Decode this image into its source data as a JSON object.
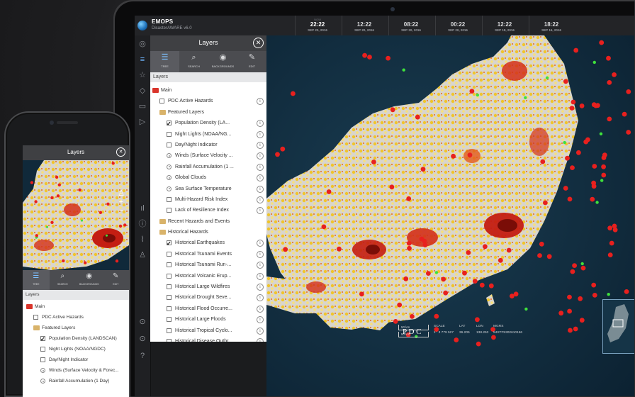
{
  "app": {
    "name": "EMOPS",
    "subtitle": "DisasterAWARE v6.0"
  },
  "timeline": [
    {
      "time": "22:22",
      "date": "SEP 20, 2016",
      "label": "NOW",
      "now": true
    },
    {
      "time": "12:22",
      "date": "SEP 20, 2016",
      "label": ""
    },
    {
      "time": "08:22",
      "date": "SEP 20, 2016",
      "label": ""
    },
    {
      "time": "00:22",
      "date": "SEP 20, 2016",
      "label": ""
    },
    {
      "time": "12:22",
      "date": "SEP 18, 2016",
      "label": ""
    },
    {
      "time": "18:22",
      "date": "SEP 16, 2016",
      "label": ""
    }
  ],
  "panel": {
    "title": "Layers",
    "tabs": [
      {
        "label": "TREE",
        "icon": "tree-icon"
      },
      {
        "label": "SEARCH",
        "icon": "search-icon"
      },
      {
        "label": "BACKGROUNDS",
        "icon": "globe-icon"
      },
      {
        "label": "EDIT",
        "icon": "pencil-icon"
      }
    ],
    "section_label": "Layers",
    "items": [
      {
        "label": "Main",
        "kind": "folder-red",
        "indent": 0
      },
      {
        "label": "PDC Active Hazards",
        "kind": "checkbox",
        "indent": 1,
        "checked": false,
        "info": true
      },
      {
        "label": "Featured Layers",
        "kind": "folder",
        "indent": 1
      },
      {
        "label": "Population Density (LA...",
        "kind": "checkbox",
        "indent": 2,
        "checked": true,
        "info": true
      },
      {
        "label": "Night Lights (NOAA/NG...",
        "kind": "checkbox",
        "indent": 2,
        "checked": false,
        "info": true
      },
      {
        "label": "Day/Night Indicator",
        "kind": "checkbox",
        "indent": 2,
        "checked": false,
        "info": true
      },
      {
        "label": "Winds (Surface Velocity ...",
        "kind": "radio",
        "indent": 2,
        "info": true
      },
      {
        "label": "Rainfall Accumulation (1 ...",
        "kind": "radio",
        "indent": 2,
        "info": true
      },
      {
        "label": "Global Clouds",
        "kind": "radio",
        "indent": 2,
        "info": true
      },
      {
        "label": "Sea Surface Temperature",
        "kind": "radio",
        "indent": 2,
        "info": true
      },
      {
        "label": "Multi-Hazard Risk Index",
        "kind": "checkbox",
        "indent": 2,
        "checked": false,
        "info": true
      },
      {
        "label": "Lack of Resilience Index",
        "kind": "checkbox",
        "indent": 2,
        "checked": false,
        "info": true
      },
      {
        "label": "Recent Hazards and Events",
        "kind": "folder",
        "indent": 1
      },
      {
        "label": "Historical Hazards",
        "kind": "folder",
        "indent": 1
      },
      {
        "label": "Historical Earthquakes",
        "kind": "checkbox",
        "indent": 2,
        "checked": true,
        "info": true
      },
      {
        "label": "Historical Tsunami Events",
        "kind": "checkbox",
        "indent": 2,
        "checked": false,
        "info": true
      },
      {
        "label": "Historical Tsunami Run-...",
        "kind": "checkbox",
        "indent": 2,
        "checked": false,
        "info": true
      },
      {
        "label": "Historical Volcanic Erup...",
        "kind": "checkbox",
        "indent": 2,
        "checked": false,
        "info": true
      },
      {
        "label": "Historical Large Wildfires",
        "kind": "checkbox",
        "indent": 2,
        "checked": false,
        "info": true
      },
      {
        "label": "Historical Drought Seve...",
        "kind": "checkbox",
        "indent": 2,
        "checked": false,
        "info": true
      },
      {
        "label": "Historical Flood Occurre...",
        "kind": "checkbox",
        "indent": 2,
        "checked": false,
        "info": true
      },
      {
        "label": "Historical Large Floods",
        "kind": "checkbox",
        "indent": 2,
        "checked": false,
        "info": true
      },
      {
        "label": "Historical Tropical Cyclo...",
        "kind": "checkbox",
        "indent": 2,
        "checked": false,
        "info": true
      },
      {
        "label": "Historical Disease Outbr...",
        "kind": "checkbox",
        "indent": 2,
        "checked": false,
        "info": true
      }
    ]
  },
  "scale": {
    "bar1": "50 km",
    "bar2": "50 km",
    "scale_label": "SCALE",
    "scale_value": "1 : 3 779 527",
    "lat_label": "LAT",
    "lat_value": "36.205",
    "lon_label": "LON",
    "lon_value": "138.253",
    "mgrs_label": "MGRS",
    "mgrs_value": "54STF5302610166"
  },
  "pdc_logo": "P D C",
  "phone": {
    "title": "Layers",
    "tabs": [
      {
        "label": "TREE",
        "icon": "tree-icon"
      },
      {
        "label": "SEARCH",
        "icon": "search-icon"
      },
      {
        "label": "BACKGROUNDS",
        "icon": "globe-icon"
      },
      {
        "label": "EDIT",
        "icon": "pencil-icon"
      }
    ],
    "section_label": "Layers",
    "items": [
      {
        "label": "Main",
        "kind": "folder-red",
        "indent": 0
      },
      {
        "label": "PDC Active Hazards",
        "kind": "checkbox",
        "indent": 1,
        "checked": false
      },
      {
        "label": "Featured Layers",
        "kind": "folder",
        "indent": 1
      },
      {
        "label": "Population Density (LANDSCAN)",
        "kind": "checkbox",
        "indent": 2,
        "checked": true
      },
      {
        "label": "Night Lights (NOAA/NGDC)",
        "kind": "checkbox",
        "indent": 2,
        "checked": false
      },
      {
        "label": "Day/Night Indicator",
        "kind": "checkbox",
        "indent": 2,
        "checked": false
      },
      {
        "label": "Winds (Surface Velocity & Forec...",
        "kind": "radio",
        "indent": 2
      },
      {
        "label": "Rainfall Accumulation (1 Day)",
        "kind": "radio",
        "indent": 2
      }
    ]
  },
  "colors": {
    "accent": "#6fb6ff",
    "quake": "#e8201e",
    "volcano": "#3fe13c",
    "density": "#f2c21b"
  }
}
